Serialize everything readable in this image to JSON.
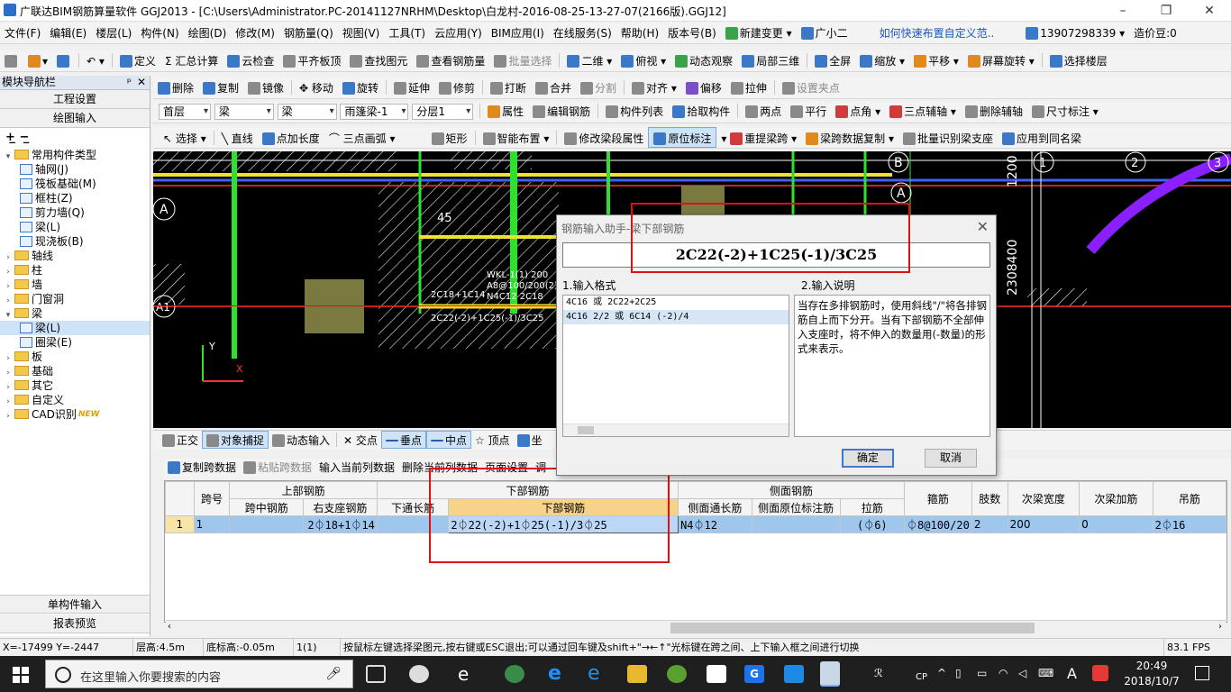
{
  "window": {
    "title": "广联达BIM钢筋算量软件 GGJ2013 - [C:\\Users\\Administrator.PC-20141127NRHM\\Desktop\\白龙村-2016-08-25-13-27-07(2166版).GGJ12]",
    "controls": [
      "–",
      "❐",
      "✕"
    ]
  },
  "menu": {
    "items": [
      "文件(F)",
      "编辑(E)",
      "楼层(L)",
      "构件(N)",
      "绘图(D)",
      "修改(M)",
      "钢筋量(Q)",
      "视图(V)",
      "工具(T)",
      "云应用(Y)",
      "BIM应用(I)",
      "在线服务(S)",
      "帮助(H)",
      "版本号(B)"
    ],
    "new_change": "新建变更",
    "guang_xiao_er": "广小二",
    "help_link": "如何快速布置自定义范..",
    "phone": "13907298339",
    "price_bean": "造价豆:0"
  },
  "toolbar1": [
    "定义",
    "汇总计算",
    "云检查",
    "平齐板顶",
    "查找图元",
    "查看钢筋量",
    "批量选择",
    "二维",
    "俯视",
    "动态观察",
    "局部三维",
    "全屏",
    "缩放",
    "平移",
    "屏幕旋转",
    "选择楼层"
  ],
  "toolbar2": [
    "删除",
    "复制",
    "镜像",
    "移动",
    "旋转",
    "延伸",
    "修剪",
    "打断",
    "合并",
    "分割",
    "对齐",
    "偏移",
    "拉伸",
    "设置夹点"
  ],
  "toolbar3": {
    "combos": [
      "首层",
      "梁",
      "梁",
      "雨篷梁-1",
      "分层1"
    ],
    "items": [
      "属性",
      "编辑钢筋",
      "构件列表",
      "拾取构件",
      "两点",
      "平行",
      "点角",
      "三点辅轴",
      "删除辅轴",
      "尺寸标注"
    ]
  },
  "toolbar4": [
    "选择",
    "直线",
    "点加长度",
    "三点画弧",
    "矩形",
    "智能布置",
    "修改梁段属性",
    "原位标注",
    "重提梁跨",
    "梁跨数据复制",
    "批量识别梁支座",
    "应用到同名梁"
  ],
  "left_panel": {
    "title": "模块导航栏",
    "pin": "ᵖ",
    "close": "✕",
    "project_settings": "工程设置",
    "drawing_input": "绘图输入",
    "tree": [
      {
        "label": "常用构件类型",
        "level": 0,
        "type": "folder",
        "open": true
      },
      {
        "label": "轴网(J)",
        "level": 1,
        "type": "leaf"
      },
      {
        "label": "筏板基础(M)",
        "level": 1,
        "type": "leaf"
      },
      {
        "label": "框柱(Z)",
        "level": 1,
        "type": "leaf"
      },
      {
        "label": "剪力墙(Q)",
        "level": 1,
        "type": "leaf"
      },
      {
        "label": "梁(L)",
        "level": 1,
        "type": "leaf"
      },
      {
        "label": "现浇板(B)",
        "level": 1,
        "type": "leaf"
      },
      {
        "label": "轴线",
        "level": 0,
        "type": "folder"
      },
      {
        "label": "柱",
        "level": 0,
        "type": "folder"
      },
      {
        "label": "墙",
        "level": 0,
        "type": "folder"
      },
      {
        "label": "门窗洞",
        "level": 0,
        "type": "folder"
      },
      {
        "label": "梁",
        "level": 0,
        "type": "folder",
        "open": true
      },
      {
        "label": "梁(L)",
        "level": 1,
        "type": "leaf",
        "selected": true
      },
      {
        "label": "圈梁(E)",
        "level": 1,
        "type": "leaf"
      },
      {
        "label": "板",
        "level": 0,
        "type": "folder"
      },
      {
        "label": "基础",
        "level": 0,
        "type": "folder"
      },
      {
        "label": "其它",
        "level": 0,
        "type": "folder"
      },
      {
        "label": "自定义",
        "level": 0,
        "type": "folder"
      },
      {
        "label": "CAD识别",
        "level": 0,
        "type": "folder",
        "badge": "NEW"
      }
    ],
    "single_input": "单构件输入",
    "report_preview": "报表预览"
  },
  "canvas": {
    "labels": {
      "axis_a_left": "A",
      "axis_a1": "A1",
      "axis_b": "B",
      "axis_a_right": "A",
      "axis_1": "1",
      "axis_2": "2",
      "axis_3": "3",
      "dim_1200": "1200",
      "dim_8400": "2308400",
      "num_45": "45",
      "beam_text_1": "WKL-1(1) 200",
      "beam_text_2": "A8@100/200(2)",
      "beam_text_3": "N4C12 2C18",
      "beam_text_4": "2C18+1C14",
      "beam_text_5": "2C22(-2)+1C25(-1)/3C25",
      "coord_y": "Y",
      "coord_x": "X"
    }
  },
  "dialog": {
    "title": "钢筋输入助手-梁下部钢筋",
    "input_value": "2C22(-2)+1C25(-1)/3C25",
    "section1": "1.输入格式",
    "formats": [
      "4C16 或 2C22+2C25",
      "4C16 2/2 或 6C14 (-2)/4"
    ],
    "section2": "2.输入说明",
    "description": "当存在多排钢筋时，使用斜线\"/\"将各排钢筋自上而下分开。当有下部钢筋不全部伸入支座时，将不伸入的数量用(-数量)的形式来表示。",
    "ok": "确定",
    "cancel": "取消"
  },
  "snapbar": [
    "正交",
    "对象捕捉",
    "动态输入",
    "交点",
    "垂点",
    "中点",
    "顶点",
    "坐"
  ],
  "table_toolbar": [
    "复制跨数据",
    "粘贴跨数据",
    "输入当前列数据",
    "删除当前列数据",
    "页面设置",
    "调"
  ],
  "grid": {
    "group_headers": {
      "top": "上部钢筋",
      "bottom": "下部钢筋",
      "side": "侧面钢筋"
    },
    "columns": {
      "span": "跨号",
      "mid_span": "跨中钢筋",
      "right_support": "右支座钢筋",
      "through_long": "下通长筋",
      "bottom_bar": "下部钢筋",
      "side_through": "侧面通长筋",
      "side_in_situ": "侧面原位标注筋",
      "tie": "拉筋",
      "stirrup": "箍筋",
      "legs": "肢数",
      "sec_width": "次梁宽度",
      "sec_add": "次梁加筋",
      "hanger": "吊筋"
    },
    "rows": [
      {
        "row_no": "1",
        "span": "1",
        "mid_span": "",
        "right_support": "2⏀18+1⏀14",
        "through_long": "",
        "bottom_bar": "2⏀22(-2)+1⏀25(-1)/3⏀25",
        "side_through": "N4⏀12",
        "side_in_situ": "",
        "tie": "(⏀6)",
        "stirrup": "⏀8@100/20",
        "legs": "2",
        "sec_width": "200",
        "sec_add": "0",
        "hanger": "2⏀16"
      }
    ]
  },
  "status": {
    "coords": "X=-17499 Y=-2447",
    "floor_height": "层高:4.5m",
    "bottom_elev": "底标高:-0.05m",
    "span_info": "1(1)",
    "hint": "按鼠标左键选择梁图元,按右键或ESC退出;可以通过回车键及shift+\"→←↑\"光标键在跨之间、上下输入框之间进行切换",
    "fps": "83.1 FPS"
  },
  "taskbar": {
    "search_placeholder": "在这里输入你要搜索的内容",
    "time": "20:49",
    "date": "2018/10/7",
    "ime": "A",
    "cp": "CP"
  },
  "colors": {
    "accent": "#3c78d8",
    "highlight_red": "#e01010",
    "row_blue": "#9fc6ee",
    "canvas_bg": "#000000"
  }
}
